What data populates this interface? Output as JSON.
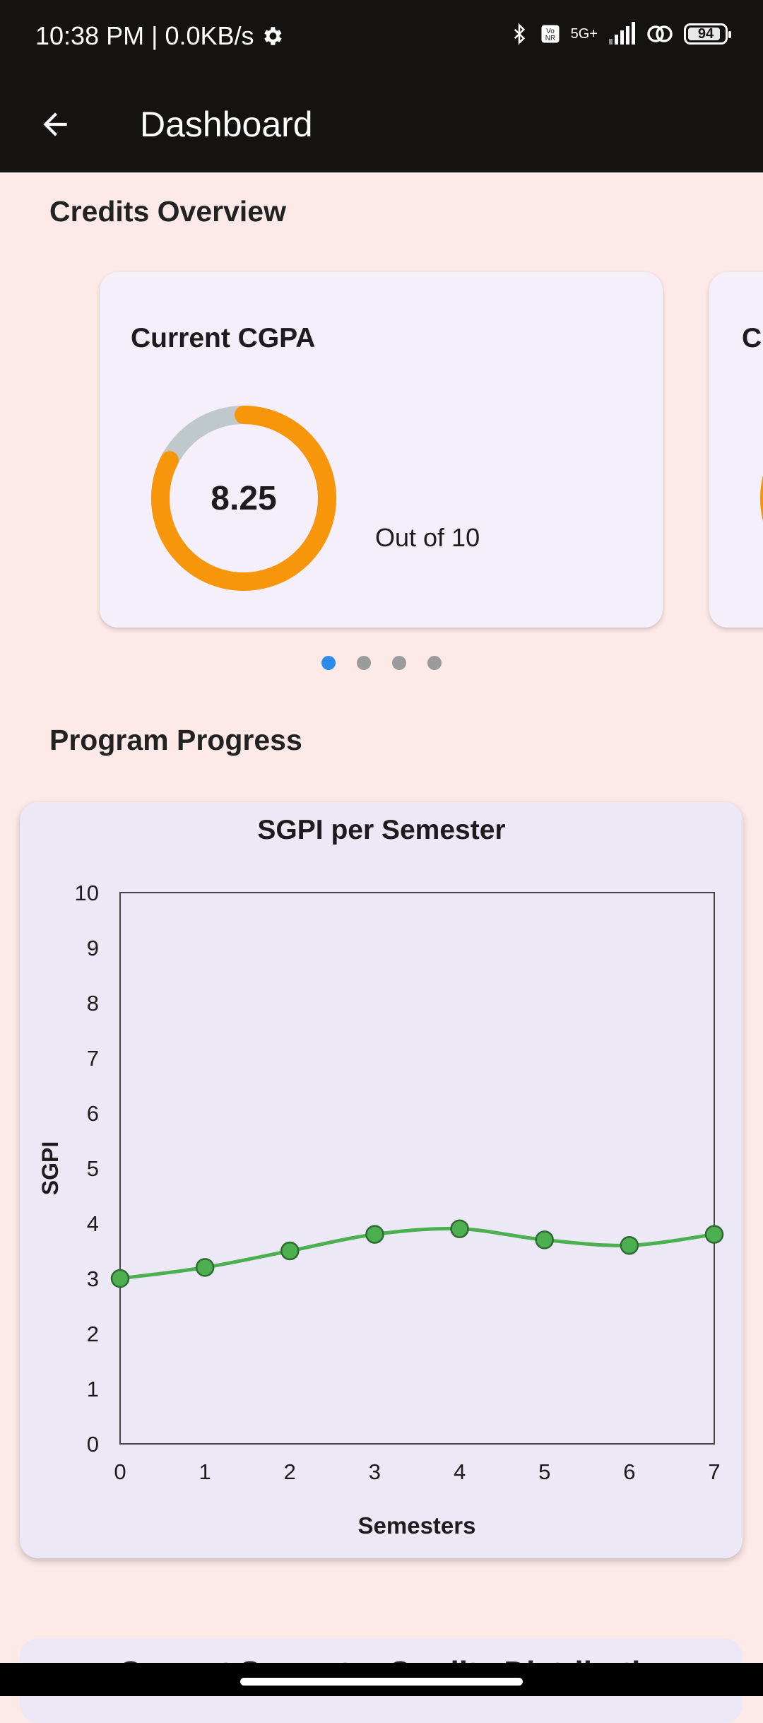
{
  "status_bar": {
    "time_speed": "10:38 PM | 0.0KB/s",
    "network": "5G+",
    "battery": "94"
  },
  "app_bar": {
    "title": "Dashboard",
    "back_icon": "arrow-left-icon"
  },
  "credits_overview": {
    "title": "Credits Overview",
    "cgpa_card": {
      "title": "Current CGPA",
      "value": "8.25",
      "out_of": "Out of 10",
      "progress_fraction": 0.825
    },
    "next_card": {
      "title": "Cr"
    },
    "pager": {
      "count": 4,
      "active_index": 0
    }
  },
  "program_progress": {
    "title": "Program Progress"
  },
  "colors": {
    "accent_orange": "#f7960a",
    "donut_track": "#bfc9cc",
    "line_green": "#4caf50",
    "pager_active": "#2a8ce8",
    "pager_inactive": "#9b9b9b"
  },
  "chart_data": {
    "type": "line",
    "title": "SGPI per Semester",
    "xlabel": "Semesters",
    "ylabel": "SGPI",
    "x": [
      0,
      1,
      2,
      3,
      4,
      5,
      6,
      7
    ],
    "series": [
      {
        "values": [
          3.0,
          3.2,
          3.5,
          3.8,
          3.9,
          3.7,
          3.6,
          3.8
        ]
      }
    ],
    "xlim": [
      0,
      7
    ],
    "ylim": [
      0,
      10
    ],
    "xticks": [
      "0",
      "1",
      "2",
      "3",
      "4",
      "5",
      "6",
      "7"
    ],
    "yticks": [
      "0",
      "1",
      "2",
      "3",
      "4",
      "5",
      "6",
      "7",
      "8",
      "9",
      "10"
    ],
    "grid": false,
    "smooth": true
  },
  "bottom_section": {
    "title": "Current Semester Credits Distribution"
  }
}
